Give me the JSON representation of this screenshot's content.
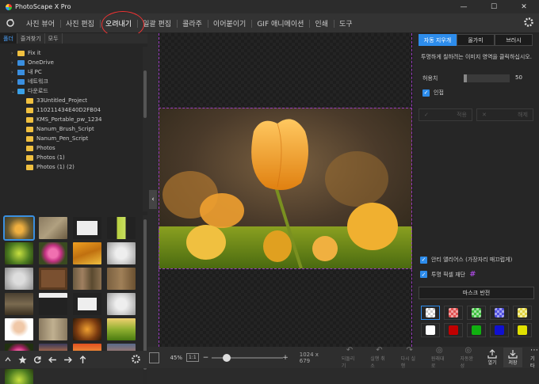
{
  "window": {
    "title": "PhotoScape X Pro",
    "minimize": "—",
    "maximize": "☐",
    "close": "✕"
  },
  "menu": {
    "tabs": [
      "사진 뷰어",
      "사진 편집",
      "오려내기",
      "일괄 편집",
      "콜라주",
      "이어붙이기",
      "GIF 애니메이션",
      "인쇄",
      "도구"
    ],
    "active": "오려내기"
  },
  "left": {
    "subtabs": [
      "폴더",
      "즐겨찾기",
      "모두"
    ],
    "tree": [
      "Fix it",
      "OneDrive",
      "내 PC",
      "네트워크",
      "다운로드",
      "33Untitled_Project",
      "110211434E40D2FB04",
      "KMS_Portable_pw_1234",
      "Nanum_Brush_Script",
      "Nanum_Pen_Script",
      "Photos",
      "Photos (1)",
      "Photos (1) (2)"
    ]
  },
  "canvas": {
    "zoom": "45%",
    "ratio": "1:1",
    "size": "1024 x 679"
  },
  "bottom": {
    "labels": [
      "되돌리기",
      "실행 취소",
      "다시 실행",
      "원래대로",
      "자동완성",
      "열기",
      "저장",
      "기타"
    ],
    "icons": [
      "open-icon",
      "save-icon",
      "more-icon"
    ]
  },
  "right": {
    "tabs": [
      "자동 지우개",
      "올가미",
      "브러시"
    ],
    "hint": "투명하게 칠하려는 이미지 영역을 클릭하십시오.",
    "tolerance_label": "허용치",
    "tolerance_value": "50",
    "adjacent_label": "인접",
    "btn_apply": "적용",
    "btn_cancel": "해제",
    "antialias_label": "안티 앨리어스 (가장자리 매끄럽게)",
    "crop_label": "투명 픽셀 재단",
    "mask_invert": "마스크 반전",
    "swatch_colors": [
      "#9a9a9a",
      "#e05050",
      "#40c040",
      "#5050e0",
      "#e0d040",
      "#ffffff",
      "#c00000",
      "#10b010",
      "#1010d0",
      "#e0e000"
    ]
  }
}
